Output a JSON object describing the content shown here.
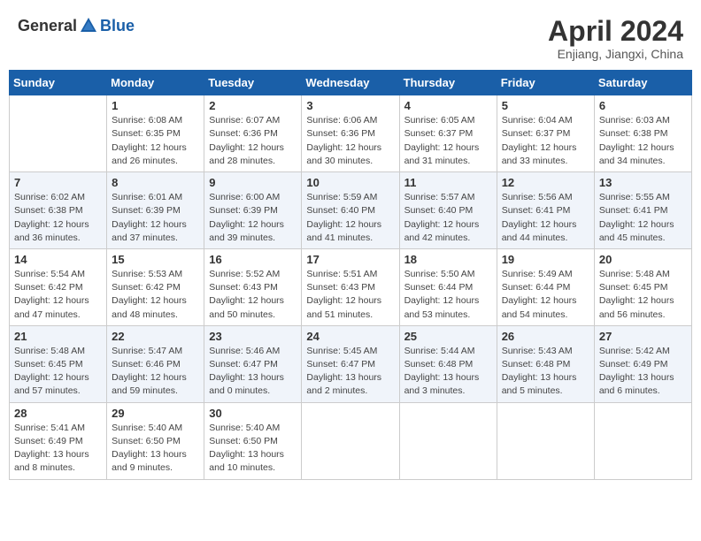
{
  "header": {
    "logo": {
      "text1": "General",
      "text2": "Blue"
    },
    "title": "April 2024",
    "location": "Enjiang, Jiangxi, China"
  },
  "calendar": {
    "days_of_week": [
      "Sunday",
      "Monday",
      "Tuesday",
      "Wednesday",
      "Thursday",
      "Friday",
      "Saturday"
    ],
    "weeks": [
      [
        {
          "day": "",
          "info": ""
        },
        {
          "day": "1",
          "info": "Sunrise: 6:08 AM\nSunset: 6:35 PM\nDaylight: 12 hours\nand 26 minutes."
        },
        {
          "day": "2",
          "info": "Sunrise: 6:07 AM\nSunset: 6:36 PM\nDaylight: 12 hours\nand 28 minutes."
        },
        {
          "day": "3",
          "info": "Sunrise: 6:06 AM\nSunset: 6:36 PM\nDaylight: 12 hours\nand 30 minutes."
        },
        {
          "day": "4",
          "info": "Sunrise: 6:05 AM\nSunset: 6:37 PM\nDaylight: 12 hours\nand 31 minutes."
        },
        {
          "day": "5",
          "info": "Sunrise: 6:04 AM\nSunset: 6:37 PM\nDaylight: 12 hours\nand 33 minutes."
        },
        {
          "day": "6",
          "info": "Sunrise: 6:03 AM\nSunset: 6:38 PM\nDaylight: 12 hours\nand 34 minutes."
        }
      ],
      [
        {
          "day": "7",
          "info": "Sunrise: 6:02 AM\nSunset: 6:38 PM\nDaylight: 12 hours\nand 36 minutes."
        },
        {
          "day": "8",
          "info": "Sunrise: 6:01 AM\nSunset: 6:39 PM\nDaylight: 12 hours\nand 37 minutes."
        },
        {
          "day": "9",
          "info": "Sunrise: 6:00 AM\nSunset: 6:39 PM\nDaylight: 12 hours\nand 39 minutes."
        },
        {
          "day": "10",
          "info": "Sunrise: 5:59 AM\nSunset: 6:40 PM\nDaylight: 12 hours\nand 41 minutes."
        },
        {
          "day": "11",
          "info": "Sunrise: 5:57 AM\nSunset: 6:40 PM\nDaylight: 12 hours\nand 42 minutes."
        },
        {
          "day": "12",
          "info": "Sunrise: 5:56 AM\nSunset: 6:41 PM\nDaylight: 12 hours\nand 44 minutes."
        },
        {
          "day": "13",
          "info": "Sunrise: 5:55 AM\nSunset: 6:41 PM\nDaylight: 12 hours\nand 45 minutes."
        }
      ],
      [
        {
          "day": "14",
          "info": "Sunrise: 5:54 AM\nSunset: 6:42 PM\nDaylight: 12 hours\nand 47 minutes."
        },
        {
          "day": "15",
          "info": "Sunrise: 5:53 AM\nSunset: 6:42 PM\nDaylight: 12 hours\nand 48 minutes."
        },
        {
          "day": "16",
          "info": "Sunrise: 5:52 AM\nSunset: 6:43 PM\nDaylight: 12 hours\nand 50 minutes."
        },
        {
          "day": "17",
          "info": "Sunrise: 5:51 AM\nSunset: 6:43 PM\nDaylight: 12 hours\nand 51 minutes."
        },
        {
          "day": "18",
          "info": "Sunrise: 5:50 AM\nSunset: 6:44 PM\nDaylight: 12 hours\nand 53 minutes."
        },
        {
          "day": "19",
          "info": "Sunrise: 5:49 AM\nSunset: 6:44 PM\nDaylight: 12 hours\nand 54 minutes."
        },
        {
          "day": "20",
          "info": "Sunrise: 5:48 AM\nSunset: 6:45 PM\nDaylight: 12 hours\nand 56 minutes."
        }
      ],
      [
        {
          "day": "21",
          "info": "Sunrise: 5:48 AM\nSunset: 6:45 PM\nDaylight: 12 hours\nand 57 minutes."
        },
        {
          "day": "22",
          "info": "Sunrise: 5:47 AM\nSunset: 6:46 PM\nDaylight: 12 hours\nand 59 minutes."
        },
        {
          "day": "23",
          "info": "Sunrise: 5:46 AM\nSunset: 6:47 PM\nDaylight: 13 hours\nand 0 minutes."
        },
        {
          "day": "24",
          "info": "Sunrise: 5:45 AM\nSunset: 6:47 PM\nDaylight: 13 hours\nand 2 minutes."
        },
        {
          "day": "25",
          "info": "Sunrise: 5:44 AM\nSunset: 6:48 PM\nDaylight: 13 hours\nand 3 minutes."
        },
        {
          "day": "26",
          "info": "Sunrise: 5:43 AM\nSunset: 6:48 PM\nDaylight: 13 hours\nand 5 minutes."
        },
        {
          "day": "27",
          "info": "Sunrise: 5:42 AM\nSunset: 6:49 PM\nDaylight: 13 hours\nand 6 minutes."
        }
      ],
      [
        {
          "day": "28",
          "info": "Sunrise: 5:41 AM\nSunset: 6:49 PM\nDaylight: 13 hours\nand 8 minutes."
        },
        {
          "day": "29",
          "info": "Sunrise: 5:40 AM\nSunset: 6:50 PM\nDaylight: 13 hours\nand 9 minutes."
        },
        {
          "day": "30",
          "info": "Sunrise: 5:40 AM\nSunset: 6:50 PM\nDaylight: 13 hours\nand 10 minutes."
        },
        {
          "day": "",
          "info": ""
        },
        {
          "day": "",
          "info": ""
        },
        {
          "day": "",
          "info": ""
        },
        {
          "day": "",
          "info": ""
        }
      ]
    ]
  }
}
